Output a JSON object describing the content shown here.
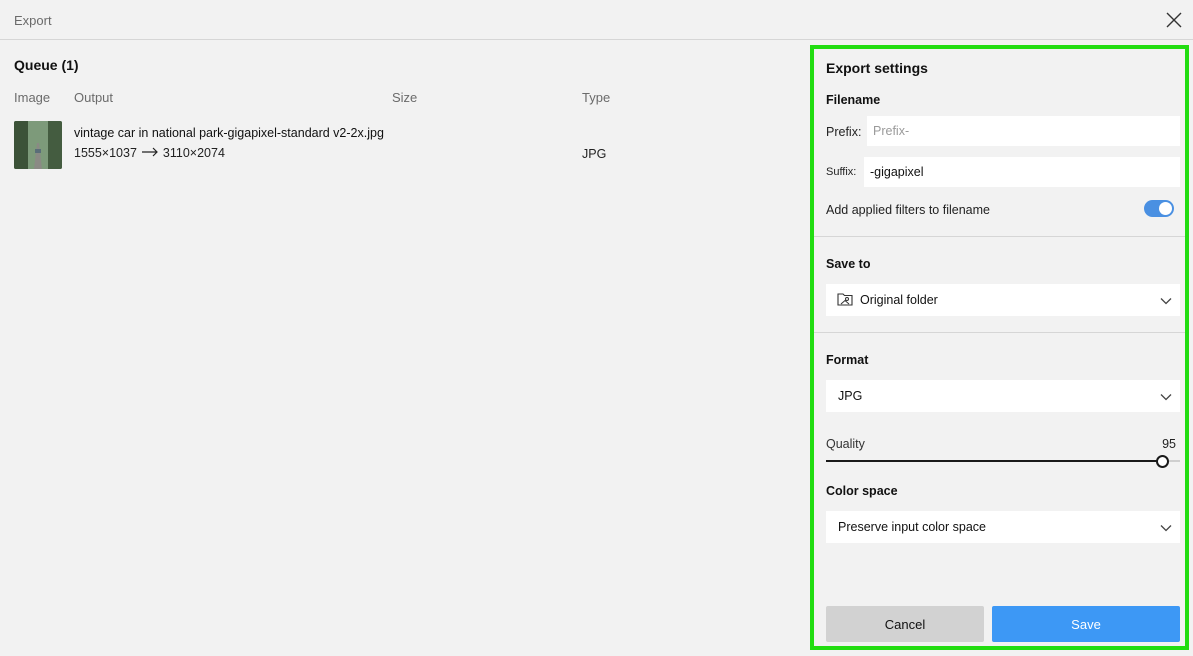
{
  "window": {
    "title": "Export"
  },
  "queue": {
    "title": "Queue (1)",
    "columns": {
      "image": "Image",
      "output": "Output",
      "size": "Size",
      "type": "Type"
    },
    "items": [
      {
        "filename": "vintage car in national park-gigapixel-standard v2-2x.jpg",
        "input_dims": "1555×1037",
        "output_dims": "3110×2074",
        "size": "",
        "type": "JPG"
      }
    ]
  },
  "settings": {
    "heading": "Export settings",
    "filename": {
      "label": "Filename",
      "prefix_label": "Prefix:",
      "prefix_value": "",
      "prefix_placeholder": "Prefix-",
      "suffix_label": "Suffix:",
      "suffix_value": "-gigapixel",
      "add_filters_label": "Add applied filters to filename",
      "add_filters_on": true
    },
    "save_to": {
      "label": "Save to",
      "value": "Original folder"
    },
    "format": {
      "label": "Format",
      "value": "JPG"
    },
    "quality": {
      "label": "Quality",
      "value": "95",
      "fraction": 0.95
    },
    "color_space": {
      "label": "Color space",
      "value": "Preserve input color space"
    },
    "buttons": {
      "cancel": "Cancel",
      "save": "Save"
    }
  },
  "colors": {
    "accent": "#3d98f5",
    "highlight": "#22dd11",
    "toggle": "#4a90e2"
  },
  "icons": [
    "close-icon",
    "folder-image-icon",
    "chevron-down-icon",
    "arrow-right-icon"
  ]
}
